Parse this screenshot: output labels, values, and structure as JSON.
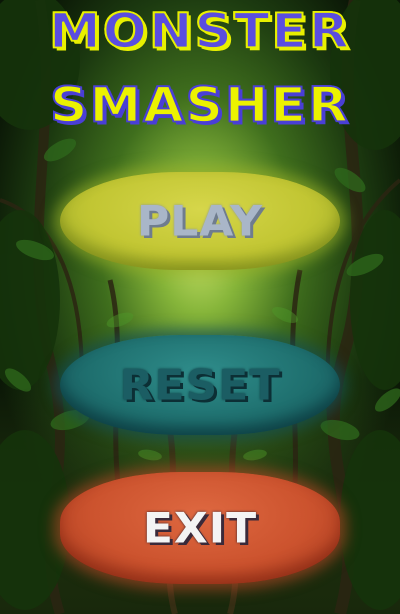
{
  "title": {
    "line1": "MONSTER",
    "line2": "SMASHER"
  },
  "menu": {
    "play_label": "PLAY",
    "reset_label": "RESET",
    "exit_label": "EXIT"
  },
  "colors": {
    "title_primary": "#5a4de0",
    "title_secondary": "#ecf200",
    "play_button": "#c2c633",
    "reset_button": "#1f706f",
    "exit_button": "#cc532e"
  },
  "background": "jungle-forest"
}
